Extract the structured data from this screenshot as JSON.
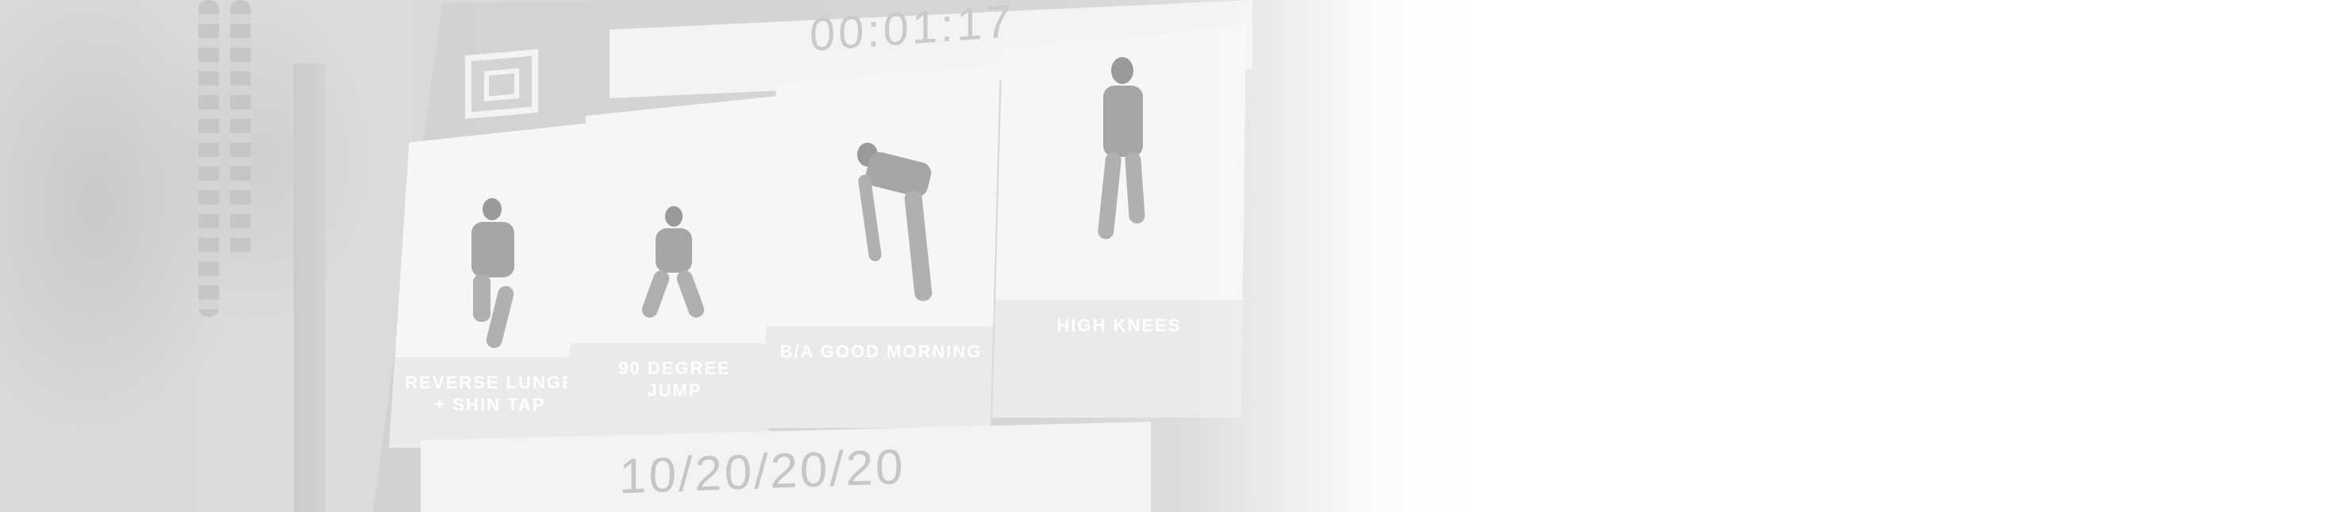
{
  "screen": {
    "timer": "00:01:17",
    "date_format": "10/20/20/20"
  },
  "exercises": [
    {
      "label": "REVERSE LUNGE + SHIN TAP",
      "line1": "REVERSE LUNGE",
      "line2": "+ SHIN TAP"
    },
    {
      "label": "90 DEGREE JUMP",
      "line1": "90 DEGREE",
      "line2": "JUMP"
    },
    {
      "label": "B/A GOOD MORNING",
      "line1": "B/A GOOD MORNING",
      "line2": ""
    },
    {
      "label": "HIGH KNEES",
      "line1": "HIGH KNEES",
      "line2": ""
    }
  ],
  "icons": {
    "logo": "brand-logo-icon"
  },
  "colors": {
    "screen_panel": "#f6f6f6",
    "caption_band": "#eaeaea",
    "background": "#d9d9d9"
  }
}
